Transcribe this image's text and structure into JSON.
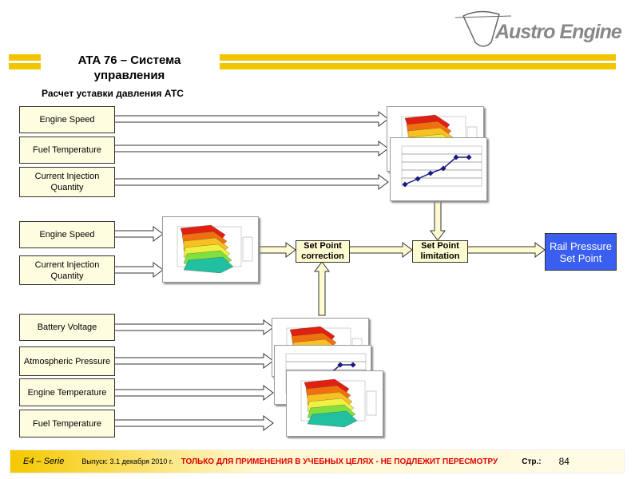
{
  "logo": {
    "text": "Austro Engine"
  },
  "title": "ATA 76 – Система управления",
  "subtitle": "Расчет уставки давления АТС",
  "inputs_group1": [
    "Engine Speed",
    "Fuel Temperature",
    "Current Injection Quantity"
  ],
  "inputs_group2": [
    "Engine Speed",
    "Current Injection Quantity"
  ],
  "inputs_group3": [
    "Battery Voltage",
    "Atmospheric Pressure",
    "Engine Temperature",
    "Fuel Temperature"
  ],
  "nodes": {
    "correction": "Set Point correction",
    "limitation": "Set Point limitation",
    "output": "Rail Pressure Set Point"
  },
  "colors": {
    "accent": "#f2c500",
    "output": "#3a5ff0",
    "footer_warning": "#e00000"
  },
  "footer": {
    "series": "E4 – Serie",
    "issue": "Выпуск: 3.1 декабря 2010 г.",
    "warning": "ТОЛЬКО ДЛЯ ПРИМЕНЕНИЯ В УЧЕБНЫХ ЦЕЛЯХ - НЕ ПОДЛЕЖИТ ПЕРЕСМОТРУ",
    "page_label": "Стр.:",
    "page_number": "84"
  }
}
